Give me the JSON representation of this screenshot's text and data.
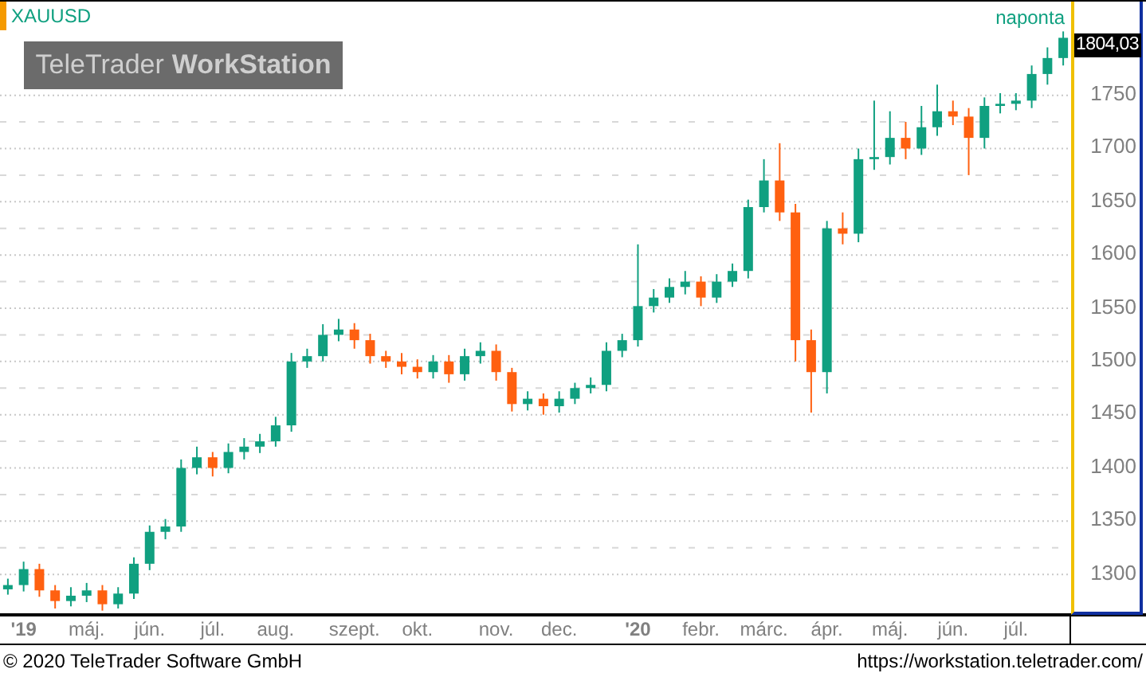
{
  "logo": {
    "brand": "TeleTrader",
    "product": "WorkStation"
  },
  "interval": "naponta",
  "last_price": "1804,03",
  "chart_data": {
    "type": "candlestick",
    "title": "XAUUSD",
    "ylim": [
      1262,
      1838
    ],
    "grid": true,
    "yticks": [
      1300,
      1350,
      1400,
      1450,
      1500,
      1550,
      1600,
      1650,
      1700,
      1750
    ],
    "categories": [
      null,
      "'19",
      null,
      null,
      null,
      "máj.",
      null,
      null,
      null,
      "jún.",
      null,
      null,
      null,
      "júl.",
      null,
      null,
      null,
      "aug.",
      null,
      null,
      null,
      null,
      "szept.",
      null,
      null,
      null,
      "okt.",
      null,
      null,
      null,
      null,
      "nov.",
      null,
      null,
      null,
      "dec.",
      null,
      null,
      null,
      null,
      "'20",
      null,
      null,
      null,
      "febr.",
      null,
      null,
      null,
      "márc.",
      null,
      null,
      null,
      "ápr.",
      null,
      null,
      null,
      "máj.",
      null,
      null,
      null,
      "jún.",
      null,
      null,
      null,
      "júl.",
      null,
      null,
      null
    ],
    "ohlc": [
      [
        1286,
        1296,
        1281,
        1290
      ],
      [
        1290,
        1312,
        1284,
        1305
      ],
      [
        1305,
        1310,
        1279,
        1285
      ],
      [
        1285,
        1290,
        1268,
        1275
      ],
      [
        1275,
        1288,
        1270,
        1280
      ],
      [
        1280,
        1292,
        1274,
        1285
      ],
      [
        1285,
        1290,
        1266,
        1272
      ],
      [
        1272,
        1288,
        1268,
        1282
      ],
      [
        1282,
        1316,
        1277,
        1310
      ],
      [
        1310,
        1346,
        1304,
        1340
      ],
      [
        1340,
        1352,
        1333,
        1345
      ],
      [
        1345,
        1408,
        1340,
        1400
      ],
      [
        1400,
        1420,
        1394,
        1410
      ],
      [
        1410,
        1415,
        1392,
        1400
      ],
      [
        1400,
        1423,
        1395,
        1415
      ],
      [
        1415,
        1428,
        1408,
        1420
      ],
      [
        1420,
        1432,
        1414,
        1425
      ],
      [
        1425,
        1448,
        1420,
        1440
      ],
      [
        1440,
        1508,
        1434,
        1500
      ],
      [
        1500,
        1512,
        1494,
        1505
      ],
      [
        1505,
        1535,
        1500,
        1525
      ],
      [
        1525,
        1540,
        1519,
        1530
      ],
      [
        1530,
        1536,
        1512,
        1520
      ],
      [
        1520,
        1526,
        1498,
        1505
      ],
      [
        1505,
        1510,
        1494,
        1500
      ],
      [
        1500,
        1508,
        1488,
        1495
      ],
      [
        1495,
        1502,
        1484,
        1490
      ],
      [
        1490,
        1506,
        1484,
        1500
      ],
      [
        1500,
        1506,
        1480,
        1488
      ],
      [
        1488,
        1512,
        1482,
        1505
      ],
      [
        1505,
        1518,
        1498,
        1510
      ],
      [
        1510,
        1516,
        1482,
        1490
      ],
      [
        1490,
        1494,
        1453,
        1460
      ],
      [
        1460,
        1472,
        1454,
        1465
      ],
      [
        1465,
        1470,
        1450,
        1458
      ],
      [
        1458,
        1472,
        1452,
        1465
      ],
      [
        1465,
        1480,
        1460,
        1475
      ],
      [
        1475,
        1485,
        1470,
        1478
      ],
      [
        1478,
        1518,
        1472,
        1510
      ],
      [
        1510,
        1526,
        1504,
        1520
      ],
      [
        1520,
        1610,
        1514,
        1552
      ],
      [
        1552,
        1568,
        1546,
        1560
      ],
      [
        1560,
        1578,
        1555,
        1570
      ],
      [
        1570,
        1585,
        1563,
        1575
      ],
      [
        1575,
        1580,
        1552,
        1560
      ],
      [
        1560,
        1582,
        1555,
        1575
      ],
      [
        1575,
        1592,
        1570,
        1585
      ],
      [
        1585,
        1652,
        1578,
        1645
      ],
      [
        1645,
        1690,
        1640,
        1670
      ],
      [
        1670,
        1705,
        1632,
        1640
      ],
      [
        1640,
        1648,
        1500,
        1520
      ],
      [
        1520,
        1530,
        1452,
        1490
      ],
      [
        1490,
        1632,
        1470,
        1625
      ],
      [
        1625,
        1640,
        1610,
        1620
      ],
      [
        1620,
        1700,
        1612,
        1690
      ],
      [
        1690,
        1745,
        1680,
        1692
      ],
      [
        1692,
        1735,
        1685,
        1710
      ],
      [
        1710,
        1725,
        1690,
        1700
      ],
      [
        1700,
        1740,
        1694,
        1720
      ],
      [
        1720,
        1760,
        1712,
        1735
      ],
      [
        1735,
        1745,
        1722,
        1730
      ],
      [
        1730,
        1738,
        1675,
        1710
      ],
      [
        1710,
        1748,
        1700,
        1740
      ],
      [
        1740,
        1752,
        1733,
        1742
      ],
      [
        1742,
        1752,
        1736,
        1745
      ],
      [
        1745,
        1778,
        1738,
        1770
      ],
      [
        1770,
        1795,
        1760,
        1785
      ],
      [
        1785,
        1810,
        1778,
        1804
      ]
    ]
  },
  "copyright": "© 2020 TeleTrader Software GmbH",
  "url": "https://workstation.teletrader.com/"
}
